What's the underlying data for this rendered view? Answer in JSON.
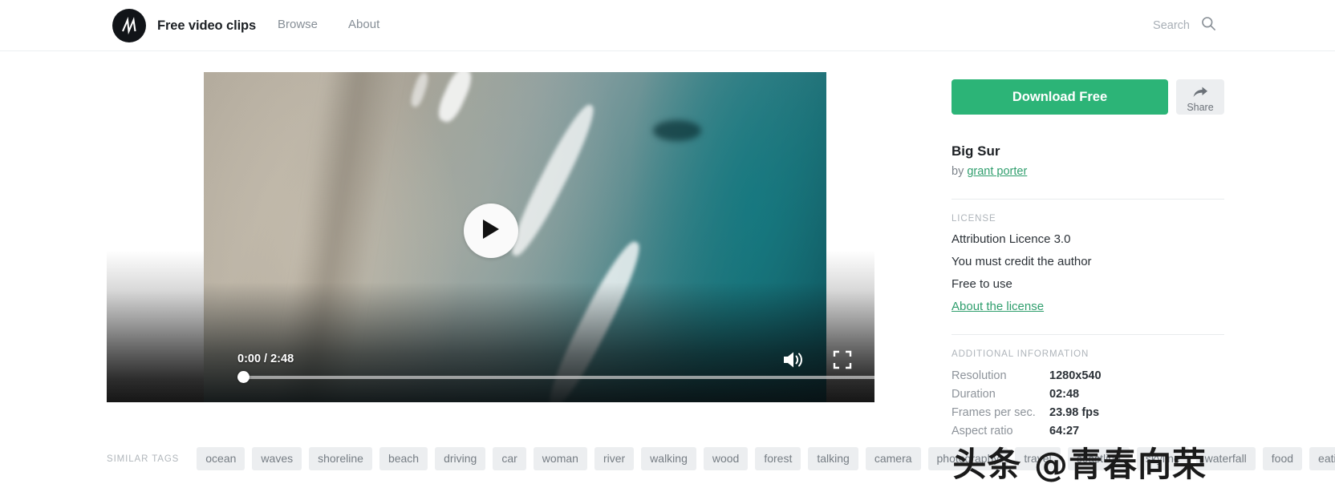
{
  "header": {
    "logo_icon": "m-monogram-logo",
    "brand_name": "Free video clips",
    "nav": [
      {
        "label": "Browse"
      },
      {
        "label": "About"
      }
    ],
    "search": {
      "placeholder": "Search",
      "value": "",
      "icon": "search-icon"
    }
  },
  "player": {
    "play_icon": "play-triangle-icon",
    "current_time": "0:00",
    "total_time": "2:48",
    "time_display": "0:00 / 2:48",
    "progress_percent": 0,
    "volume_icon": "volume-on-icon",
    "fullscreen_icon": "fullscreen-icon"
  },
  "sidebar": {
    "download_label": "Download Free",
    "download_color": "#2cb477",
    "share_label": "Share",
    "share_icon": "share-arrow-icon",
    "title": "Big Sur",
    "by_prefix": "by ",
    "author": "grant porter",
    "license": {
      "section_label": "LICENSE",
      "lines": [
        "Attribution Licence 3.0",
        "You must credit the author",
        "Free to use"
      ],
      "link_label": "About the license"
    },
    "additional": {
      "section_label": "ADDITIONAL INFORMATION",
      "rows": [
        {
          "key": "Resolution",
          "value": "1280x540"
        },
        {
          "key": "Duration",
          "value": "02:48"
        },
        {
          "key": "Frames per sec.",
          "value": "23.98 fps"
        },
        {
          "key": "Aspect ratio",
          "value": "64:27"
        }
      ]
    }
  },
  "tags": {
    "label": "SIMILAR TAGS",
    "items": [
      "ocean",
      "waves",
      "shoreline",
      "beach",
      "driving",
      "car",
      "woman",
      "river",
      "walking",
      "wood",
      "forest",
      "talking",
      "camera",
      "photography",
      "travel",
      "coastline",
      "skyline",
      "waterfall",
      "food",
      "eating"
    ]
  },
  "watermark": {
    "text": "头条 @青春向荣"
  }
}
